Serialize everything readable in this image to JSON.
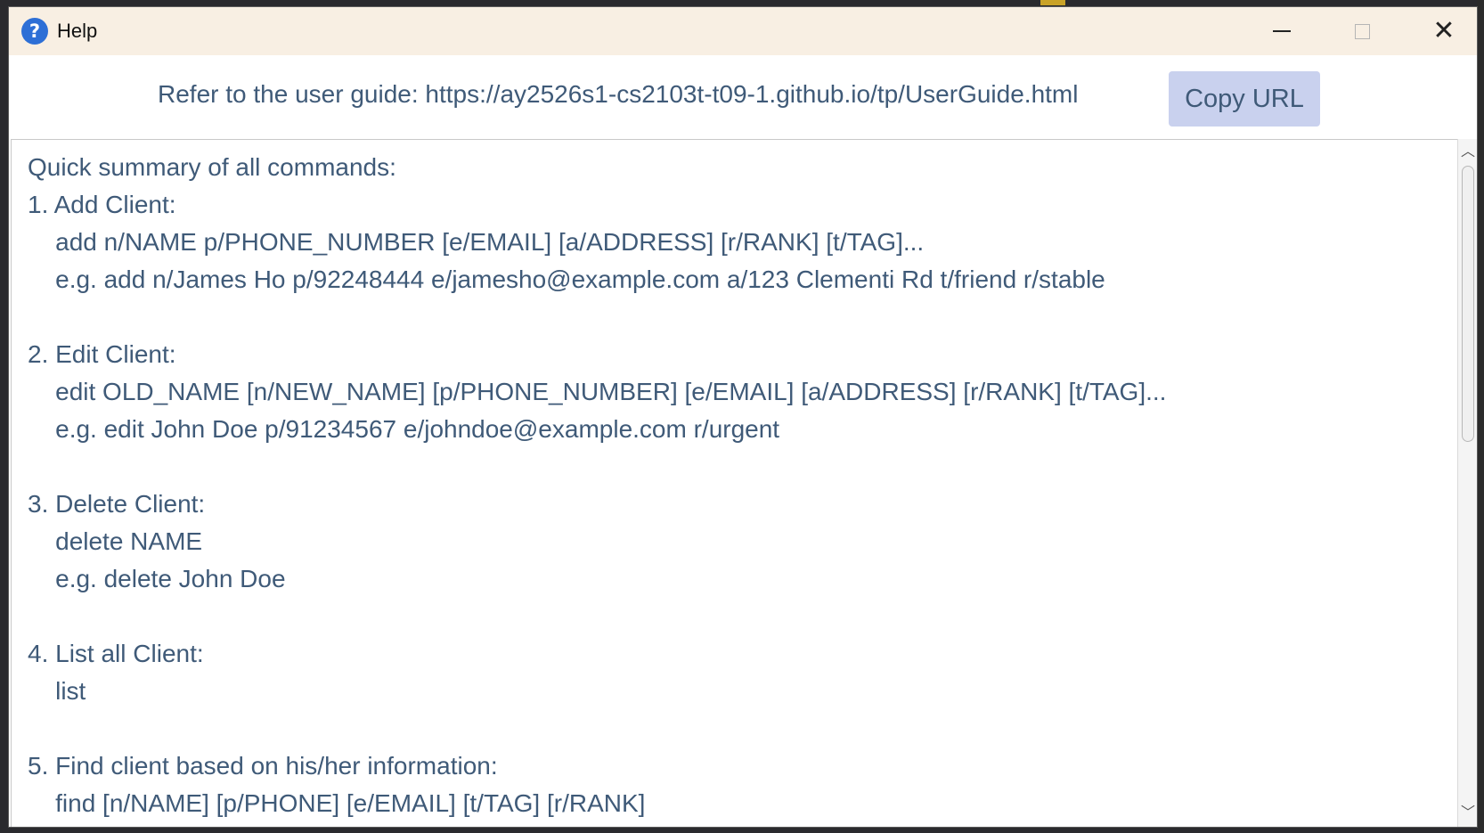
{
  "window": {
    "title": "Help",
    "help_icon_glyph": "?",
    "minimize_glyph": "",
    "close_glyph": "✕"
  },
  "url_bar": {
    "text": "Refer to the user guide: https://ay2526s1-cs2103t-t09-1.github.io/tp/UserGuide.html",
    "copy_button_label": "Copy URL"
  },
  "help_content": {
    "lines": [
      "Quick summary of all commands:",
      "1. Add Client:",
      "    add n/NAME p/PHONE_NUMBER [e/EMAIL] [a/ADDRESS] [r/RANK] [t/TAG]...",
      "    e.g. add n/James Ho p/92248444 e/jamesho@example.com a/123 Clementi Rd t/friend r/stable",
      "",
      "2. Edit Client:",
      "    edit OLD_NAME [n/NEW_NAME] [p/PHONE_NUMBER] [e/EMAIL] [a/ADDRESS] [r/RANK] [t/TAG]...",
      "    e.g. edit John Doe p/91234567 e/johndoe@example.com r/urgent",
      "",
      "3. Delete Client:",
      "    delete NAME",
      "    e.g. delete John Doe",
      "",
      "4. List all Client:",
      "    list",
      "",
      "5. Find client based on his/her information:",
      "    find [n/NAME] [p/PHONE] [e/EMAIL] [t/TAG] [r/RANK]"
    ]
  },
  "scrollbar": {
    "up_glyph": "︿",
    "down_glyph": "﹀"
  }
}
